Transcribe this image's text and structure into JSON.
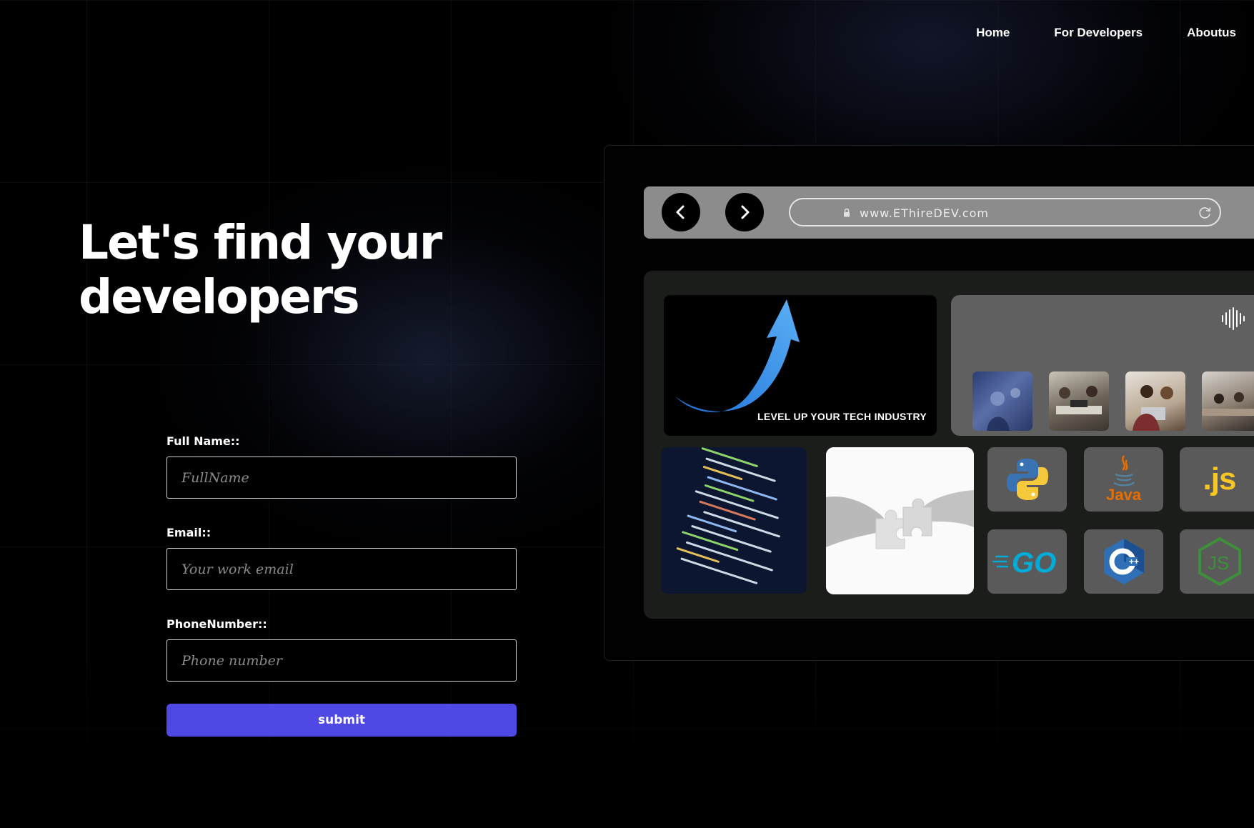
{
  "nav": {
    "items": [
      {
        "label": "Home"
      },
      {
        "label": "For Developers"
      },
      {
        "label": "Aboutus"
      }
    ]
  },
  "hero": {
    "title_line1": "Let's find your",
    "title_line2": "developers"
  },
  "form": {
    "full_name": {
      "label": "Full Name::",
      "placeholder": "FullName",
      "value": ""
    },
    "email": {
      "label": "Email::",
      "placeholder": "Your work email",
      "value": ""
    },
    "phone": {
      "label": "PhoneNumber::",
      "placeholder": "Phone number",
      "value": ""
    },
    "submit_label": "submit"
  },
  "mockup": {
    "url": "www.EThireDEV.com",
    "level_up_tag": "LEVEL UP YOUR TECH INDUSTRY",
    "languages": [
      {
        "name": "Python",
        "icon": "python-logo-icon"
      },
      {
        "name": "Java",
        "icon": "java-logo-icon"
      },
      {
        "name": "JavaScript",
        "icon": "js-logo-icon"
      },
      {
        "name": "Go",
        "icon": "go-logo-icon"
      },
      {
        "name": "C++",
        "icon": "cpp-logo-icon"
      },
      {
        "name": "Node.js",
        "icon": "nodejs-logo-icon"
      }
    ],
    "java_text": "Java",
    "js_text": ".js",
    "go_text": "GO",
    "node_text": "JS"
  },
  "colors": {
    "background": "#000000",
    "accent": "#5048e5",
    "browser_bar": "#8c8c8c",
    "panel": "#1a1d19"
  }
}
